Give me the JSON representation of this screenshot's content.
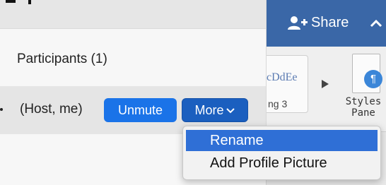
{
  "background_app": {
    "share_label": "Share",
    "style_sample": "cDdEe",
    "style_name": "ng 3",
    "styles_pane_label_line1": "Styles",
    "styles_pane_label_line2": "Pane",
    "topbar_color": "#3a67a7"
  },
  "panel": {
    "heading": "Participants (1)",
    "participant": {
      "name": "(Host, me)",
      "unmute_label": "Unmute",
      "more_label": "More"
    }
  },
  "menu": {
    "items": [
      {
        "label": "Rename",
        "highlighted": true
      },
      {
        "label": "Add Profile Picture",
        "highlighted": false
      }
    ]
  },
  "colors": {
    "button_blue": "#1a73e8",
    "menu_highlight": "#2f6fd6"
  }
}
